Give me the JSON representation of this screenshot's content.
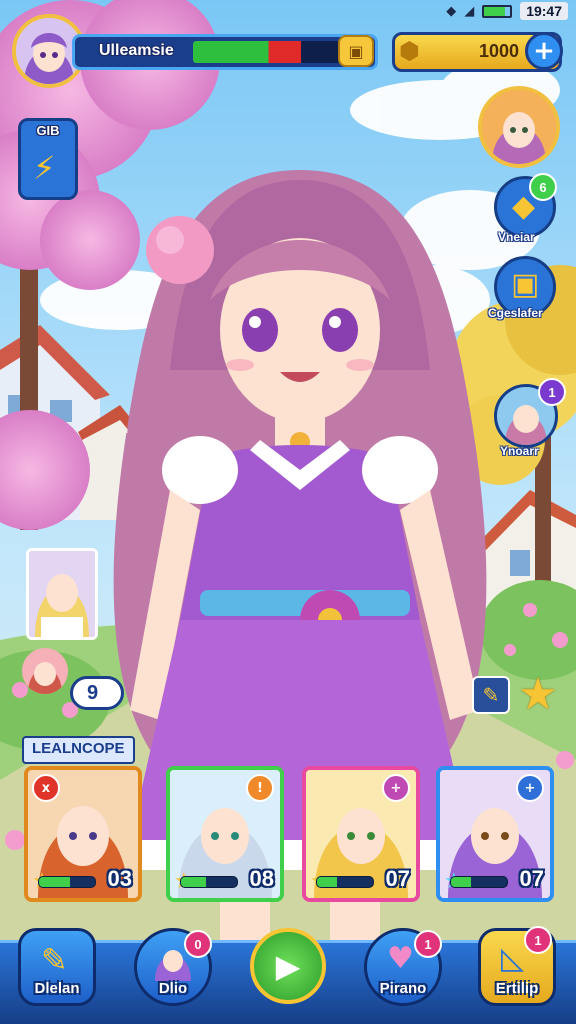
{
  "status_bar": {
    "time": "19:47"
  },
  "player": {
    "name": "Ulleamsie",
    "hp_fraction": 0.6
  },
  "currency": {
    "amount": "1000"
  },
  "left_panel": {
    "event_label": "GIB"
  },
  "side_menu": [
    {
      "label": "",
      "badge": ""
    },
    {
      "label": "Vneiar",
      "badge": "6"
    },
    {
      "label": "Cgeslafer",
      "badge": ""
    },
    {
      "label": "Ynoarr",
      "badge": "1"
    }
  ],
  "small_level": "9",
  "team_label": "LEALNCOPE",
  "cards": [
    {
      "number": "03",
      "bar": 0.55,
      "corner": "x"
    },
    {
      "number": "08",
      "bar": 0.45,
      "corner": "!"
    },
    {
      "number": "07",
      "bar": 0.35,
      "corner": "+"
    },
    {
      "number": "07",
      "bar": 0.35,
      "corner": "+"
    }
  ],
  "bottom_nav": [
    {
      "label": "Dlelan",
      "badge": ""
    },
    {
      "label": "Dlio",
      "badge": "0"
    },
    {
      "label": "",
      "badge": ""
    },
    {
      "label": "Pirano",
      "badge": "1"
    },
    {
      "label": "Ertilip",
      "badge": "1"
    }
  ],
  "colors": {
    "accent_blue": "#1f7fe0",
    "gold": "#f7c534",
    "pink": "#e0337a",
    "purple_dress": "#a35ad0"
  }
}
